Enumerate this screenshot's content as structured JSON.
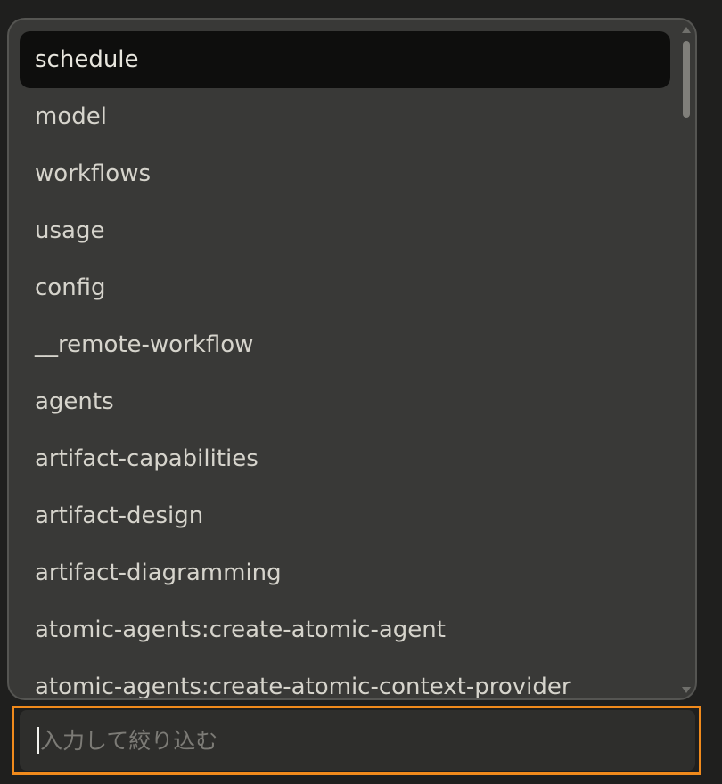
{
  "command_menu": {
    "items": [
      {
        "label": "schedule",
        "selected": true
      },
      {
        "label": "model",
        "selected": false
      },
      {
        "label": "workflows",
        "selected": false
      },
      {
        "label": "usage",
        "selected": false
      },
      {
        "label": "config",
        "selected": false
      },
      {
        "label": "__remote-workflow",
        "selected": false
      },
      {
        "label": "agents",
        "selected": false
      },
      {
        "label": "artifact-capabilities",
        "selected": false
      },
      {
        "label": "artifact-design",
        "selected": false
      },
      {
        "label": "artifact-diagramming",
        "selected": false
      },
      {
        "label": "atomic-agents:create-atomic-agent",
        "selected": false
      },
      {
        "label": "atomic-agents:create-atomic-context-provider",
        "selected": false
      }
    ]
  },
  "filter": {
    "value": "/",
    "placeholder": "入力して絞り込む"
  },
  "colors": {
    "highlight_border": "#f08a1c",
    "selected_bg": "#0e0e0d",
    "menu_bg": "#393937"
  }
}
